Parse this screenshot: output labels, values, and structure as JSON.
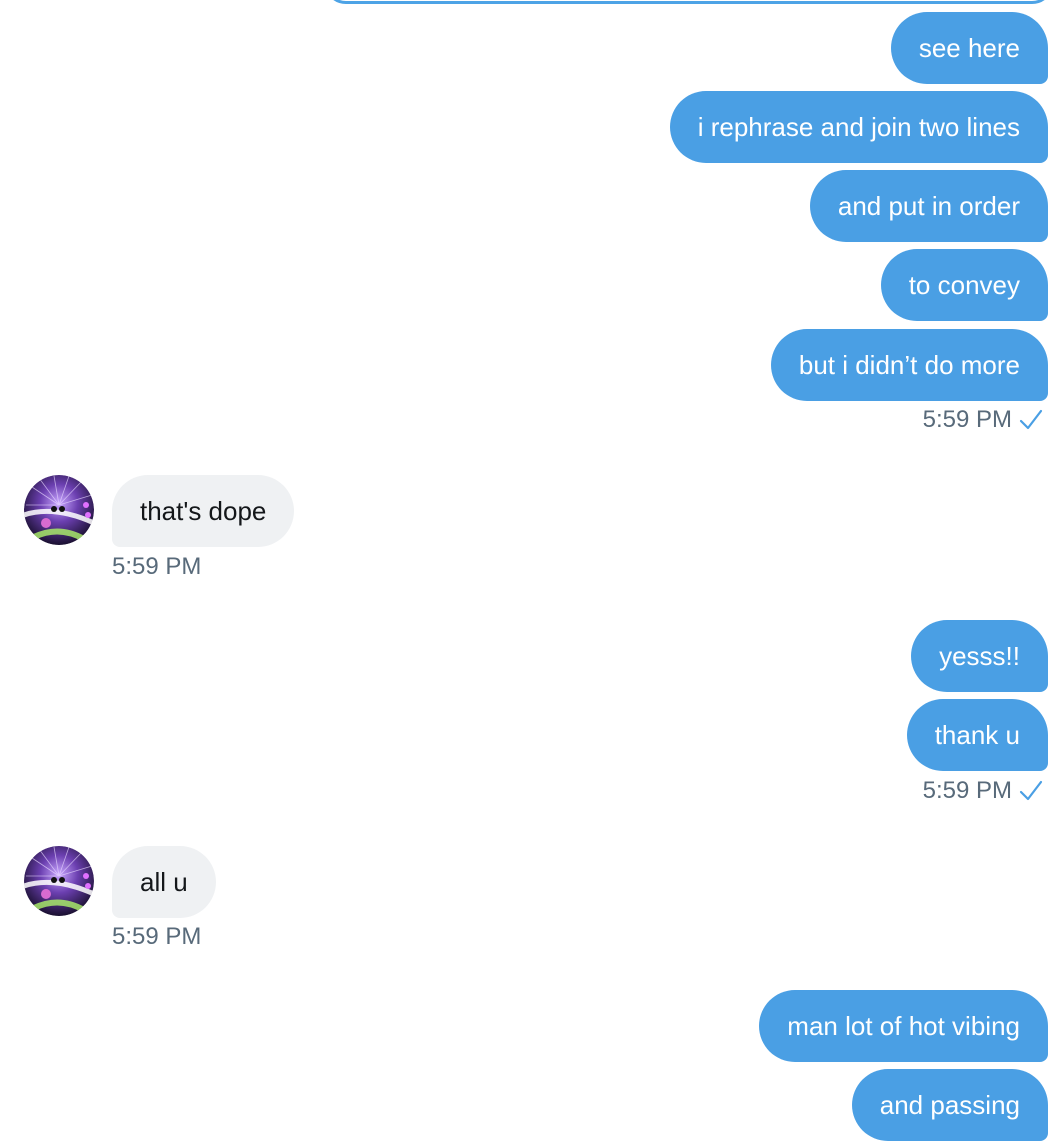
{
  "colors": {
    "sent_bubble": "#4a9fe4",
    "received_bubble": "#eff1f3",
    "timestamp": "#586a7a",
    "read_check": "#4a9fe4"
  },
  "groups": [
    {
      "sender": "me",
      "messages": [
        "see here",
        "i rephrase and join two lines",
        "and put in order",
        "to convey",
        "but i didn’t do more"
      ],
      "time": "5:59 PM",
      "status_icon": "checkmark-icon"
    },
    {
      "sender": "them",
      "avatar_icon": "avatar-image",
      "messages": [
        "that's dope"
      ],
      "time": "5:59 PM"
    },
    {
      "sender": "me",
      "messages": [
        "yesss!!",
        "thank u"
      ],
      "time": "5:59 PM",
      "status_icon": "checkmark-icon"
    },
    {
      "sender": "them",
      "avatar_icon": "avatar-image",
      "messages": [
        "all u"
      ],
      "time": "5:59 PM"
    },
    {
      "sender": "me",
      "messages": [
        "man lot of hot vibing",
        "and passing"
      ]
    }
  ]
}
